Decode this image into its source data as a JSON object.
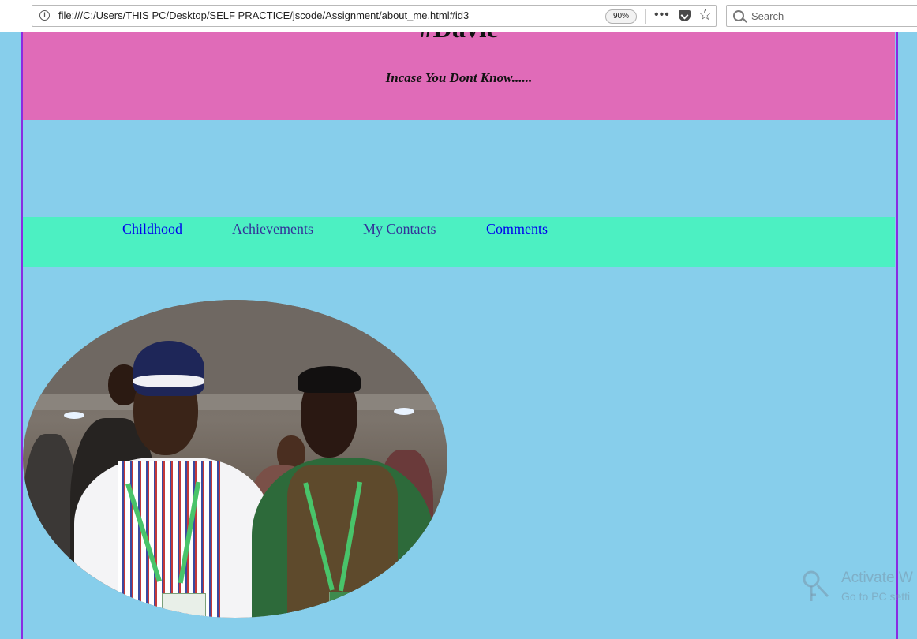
{
  "browser": {
    "url": "file:///C:/Users/THIS PC/Desktop/SELF PRACTICE/jscode/Assignment/about_me.html#id3",
    "zoom": "90%",
    "search_placeholder": "Search",
    "icons": [
      "info-icon",
      "more-icon",
      "pocket-icon",
      "star-icon",
      "search-icon"
    ]
  },
  "header": {
    "title": "#Davie",
    "tagline": "Incase You Dont Know......"
  },
  "nav": {
    "items": [
      {
        "label": "Childhood"
      },
      {
        "label": "Achievements"
      },
      {
        "label": "My Contacts"
      },
      {
        "label": "Comments"
      }
    ]
  },
  "watermark": {
    "title": "Activate W",
    "subtitle": "Go to PC setti"
  },
  "colors": {
    "page_bg": "#87ceeb",
    "header_bg": "#e06bb8",
    "nav_bg": "#4cf0c2",
    "frame_border": "#8a2be2",
    "link_unvisited": "#0000ee",
    "link_visited": "#333399"
  }
}
